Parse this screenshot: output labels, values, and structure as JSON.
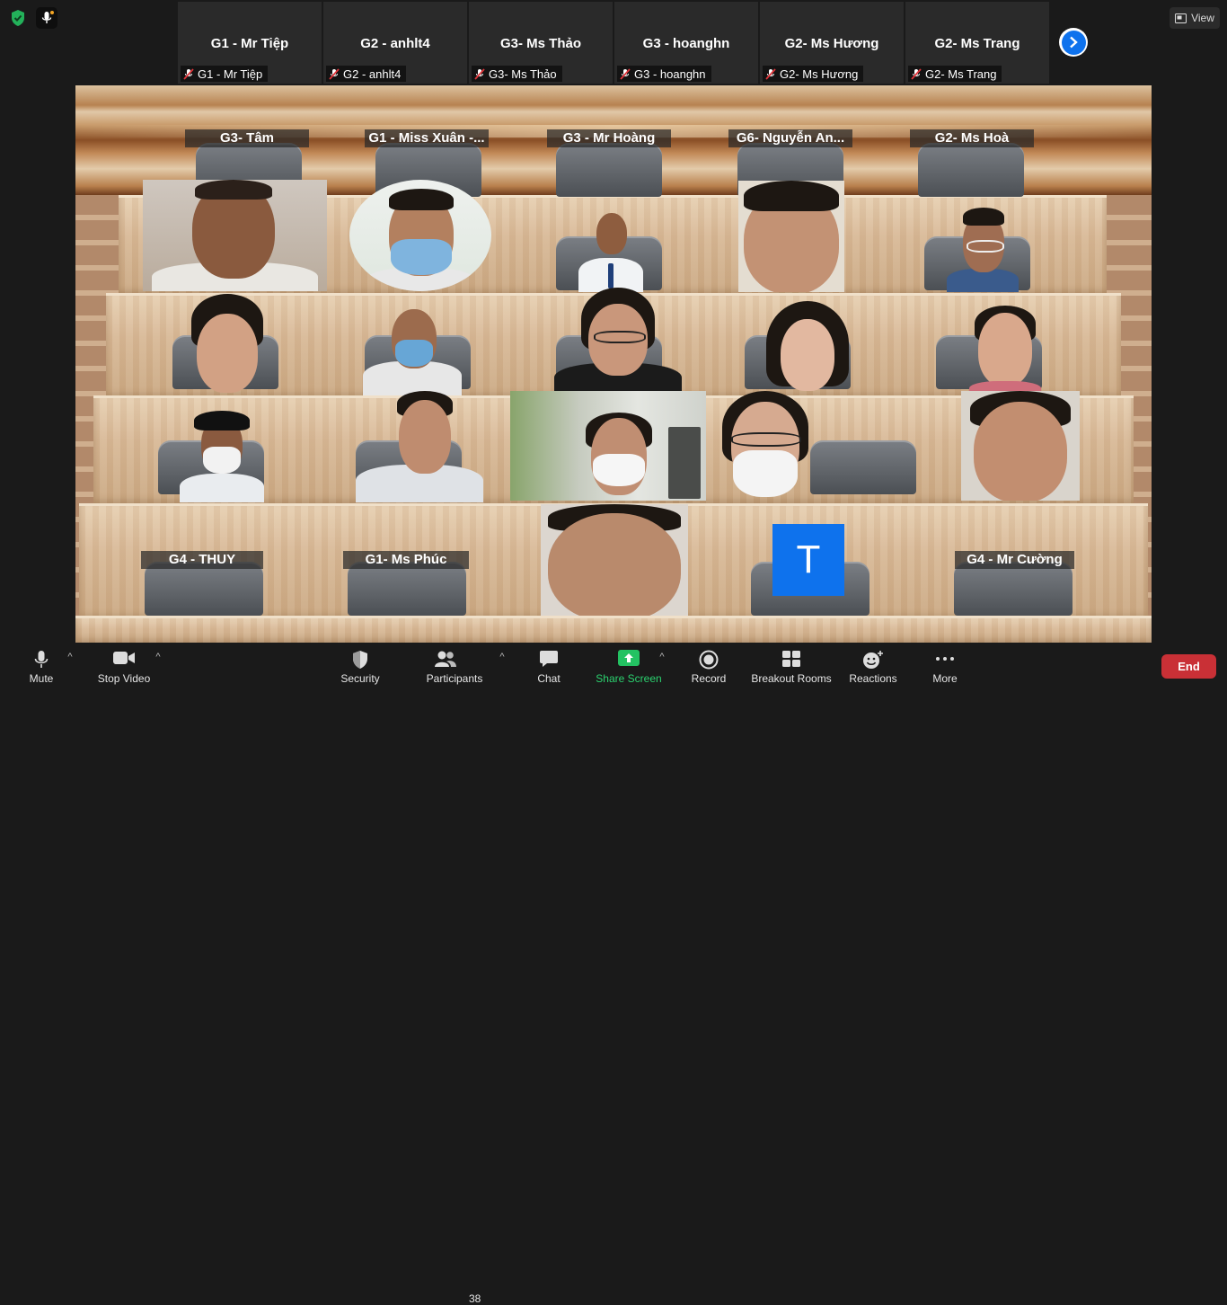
{
  "top": {
    "view_label": "View"
  },
  "strip": {
    "tiles": [
      {
        "name": "G1 - Mr Tiệp",
        "label": "G1 - Mr Tiệp"
      },
      {
        "name": "G2 - anhlt4",
        "label": "G2 - anhlt4"
      },
      {
        "name": "G3- Ms Thảo",
        "label": "G3- Ms Thảo"
      },
      {
        "name": "G3 - hoanghn",
        "label": "G3 - hoanghn"
      },
      {
        "name": "G2- Ms Hương",
        "label": "G2- Ms Hương"
      },
      {
        "name": "G2- Ms Trang",
        "label": "G2- Ms Trang"
      }
    ]
  },
  "scene": {
    "name_tags": [
      "G3- Tâm",
      "G1 - Miss Xuân -...",
      "G3 - Mr Hoàng",
      "G6- Nguyễn An...",
      "G2- Ms Hoà",
      "G4 - THUY",
      "G1- Ms Phúc",
      "G4 - Mr Cường"
    ],
    "avatar_letter": "T",
    "avatar_color": "#0e72ed"
  },
  "toolbar": {
    "mute": "Mute",
    "stop_video": "Stop Video",
    "security": "Security",
    "participants": "Participants",
    "participants_count": "38",
    "chat": "Chat",
    "share_screen": "Share Screen",
    "record": "Record",
    "breakout_rooms": "Breakout Rooms",
    "reactions": "Reactions",
    "more": "More",
    "end": "End"
  },
  "colors": {
    "share_green": "#2bd26f",
    "end_red": "#c93036",
    "accent_blue": "#0e72ed"
  }
}
